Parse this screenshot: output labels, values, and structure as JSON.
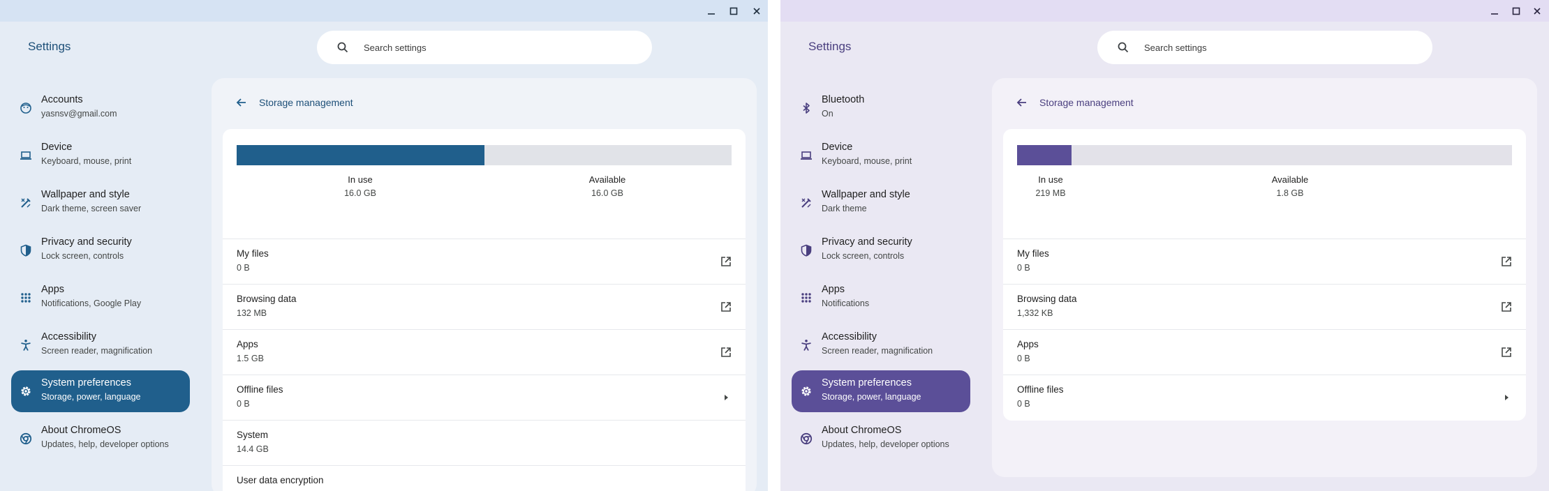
{
  "left": {
    "app_title": "Settings",
    "search_placeholder": "Search settings",
    "nav": [
      {
        "icon": "account-icon",
        "title": "Accounts",
        "subtitle": "yasnsv@gmail.com"
      },
      {
        "icon": "laptop-icon",
        "title": "Device",
        "subtitle": "Keyboard, mouse, print"
      },
      {
        "icon": "paintbrush-icon",
        "title": "Wallpaper and style",
        "subtitle": "Dark theme, screen saver"
      },
      {
        "icon": "shield-icon",
        "title": "Privacy and security",
        "subtitle": "Lock screen, controls"
      },
      {
        "icon": "apps-grid-icon",
        "title": "Apps",
        "subtitle": "Notifications, Google Play"
      },
      {
        "icon": "accessibility-icon",
        "title": "Accessibility",
        "subtitle": "Screen reader, magnification"
      },
      {
        "icon": "gear-icon",
        "title": "System preferences",
        "subtitle": "Storage, power, language",
        "active": true
      },
      {
        "icon": "chromeos-icon",
        "title": "About ChromeOS",
        "subtitle": "Updates, help, developer options"
      }
    ],
    "page_title": "Storage management",
    "storage": {
      "in_use_label": "In use",
      "in_use_value": "16.0 GB",
      "available_label": "Available",
      "available_value": "16.0 GB",
      "in_use_fraction": 0.5
    },
    "rows": [
      {
        "title": "My files",
        "value": "0 B",
        "icon": "open-external-icon"
      },
      {
        "title": "Browsing data",
        "value": "132 MB",
        "icon": "open-external-icon"
      },
      {
        "title": "Apps",
        "value": "1.5 GB",
        "icon": "open-external-icon"
      },
      {
        "title": "Offline files",
        "value": "0 B",
        "icon": "arrow-right-icon"
      },
      {
        "title": "System",
        "value": "14.4 GB",
        "icon": ""
      },
      {
        "title": "User data encryption",
        "value": "",
        "icon": ""
      }
    ]
  },
  "right": {
    "app_title": "Settings",
    "search_placeholder": "Search settings",
    "nav": [
      {
        "icon": "bluetooth-icon",
        "title": "Bluetooth",
        "subtitle": "On"
      },
      {
        "icon": "laptop-icon",
        "title": "Device",
        "subtitle": "Keyboard, mouse, print"
      },
      {
        "icon": "paintbrush-icon",
        "title": "Wallpaper and style",
        "subtitle": "Dark theme"
      },
      {
        "icon": "shield-icon",
        "title": "Privacy and security",
        "subtitle": "Lock screen, controls"
      },
      {
        "icon": "apps-grid-icon",
        "title": "Apps",
        "subtitle": "Notifications"
      },
      {
        "icon": "accessibility-icon",
        "title": "Accessibility",
        "subtitle": "Screen reader, magnification"
      },
      {
        "icon": "gear-icon",
        "title": "System preferences",
        "subtitle": "Storage, power, language",
        "active": true
      },
      {
        "icon": "chromeos-icon",
        "title": "About ChromeOS",
        "subtitle": "Updates, help, developer options"
      }
    ],
    "page_title": "Storage management",
    "storage": {
      "in_use_label": "In use",
      "in_use_value": "219 MB",
      "available_label": "Available",
      "available_value": "1.8 GB",
      "in_use_fraction": 0.11
    },
    "rows": [
      {
        "title": "My files",
        "value": "0 B",
        "icon": "open-external-icon"
      },
      {
        "title": "Browsing data",
        "value": "1,332 KB",
        "icon": "open-external-icon"
      },
      {
        "title": "Apps",
        "value": "0 B",
        "icon": "open-external-icon"
      },
      {
        "title": "Offline files",
        "value": "0 B",
        "icon": "arrow-right-icon"
      }
    ]
  },
  "colors": {
    "left_accent": "#205f8c",
    "right_accent": "#5b4f98"
  }
}
